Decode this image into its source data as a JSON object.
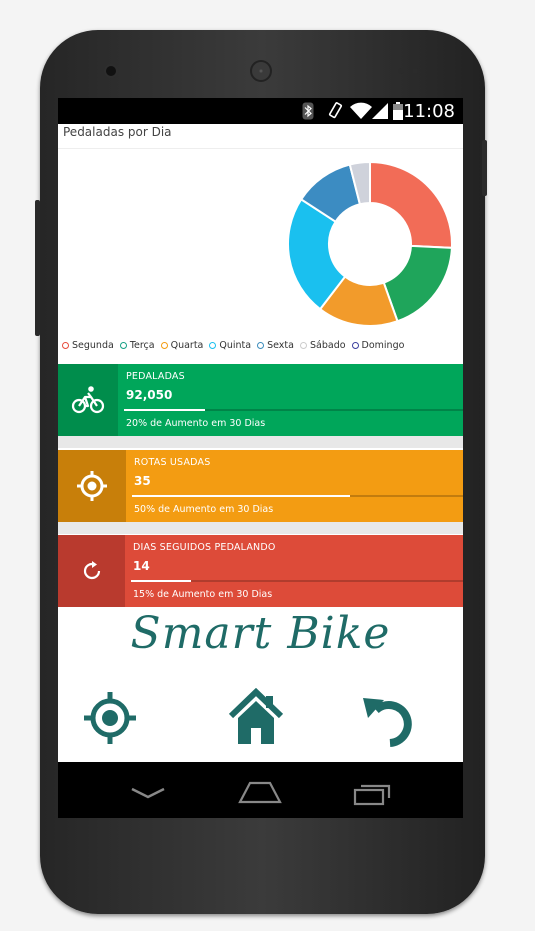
{
  "status_bar": {
    "time": "11:08",
    "icons": [
      "bluetooth-icon",
      "rotate-icon",
      "wifi-icon",
      "signal-icon",
      "battery-icon"
    ]
  },
  "chart_section": {
    "title": "Pedaladas por Dia"
  },
  "chart_data": {
    "type": "pie",
    "style": "donut",
    "title": "Pedaladas por Dia",
    "categories": [
      "Segunda",
      "Terça",
      "Quarta",
      "Quinta",
      "Sexta",
      "Sábado",
      "Domingo"
    ],
    "values": [
      26,
      19,
      16,
      24,
      12,
      4,
      0
    ],
    "colors": [
      "#f26c57",
      "#1fa55b",
      "#f29b2b",
      "#1ac0ef",
      "#3c8cc2",
      "#cfd2db",
      "#3b3f9e"
    ],
    "legend_position": "bottom",
    "legend_marker_colors": [
      "#e74c3c",
      "#16a085",
      "#f39c12",
      "#1ac0ef",
      "#3c8dbc",
      "#cccccc",
      "#3b3f9e"
    ]
  },
  "cards": [
    {
      "id": "pedaladas",
      "label": "PEDALADAS",
      "value": "92,050",
      "progress_percent": 24,
      "footer": "20% de Aumento em 30 Dias",
      "color": "#00a65a",
      "icon_box_color": "#008d4c",
      "icon": "bicycle-icon"
    },
    {
      "id": "rotas-usadas",
      "label": "ROTAS USADAS",
      "value": "35",
      "progress_percent": 66,
      "footer": "50% de Aumento em 30 Dias",
      "color": "#f39c12",
      "icon_box_color": "#c87f0a",
      "icon": "target-icon"
    },
    {
      "id": "dias-seguidos",
      "label": "DIAS SEGUIDOS PEDALANDO",
      "value": "14",
      "progress_percent": 18,
      "footer": "15% de Aumento em 30 Dias",
      "color": "#dd4b39",
      "icon_box_color": "#b93a2e",
      "icon": "refresh-icon"
    }
  ],
  "brand": {
    "name": "Smart Bike",
    "color": "#1f6b67"
  },
  "bottom_nav": {
    "icons": [
      "crosshair-icon",
      "home-icon",
      "undo-icon"
    ],
    "color": "#1f6b67"
  },
  "system_nav": {
    "icons": [
      "back-icon",
      "home-key-icon",
      "recents-icon"
    ]
  }
}
